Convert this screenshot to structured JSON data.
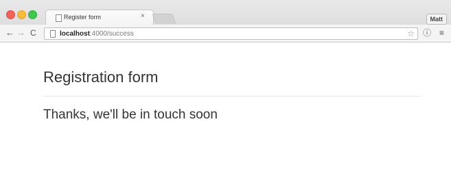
{
  "browser": {
    "tab": {
      "title": "Register form",
      "close_glyph": "×",
      "icon": "page-icon"
    },
    "profile_label": "Matt",
    "nav": {
      "back_glyph": "←",
      "forward_glyph": "→",
      "reload_glyph": "C"
    },
    "address_bar": {
      "host": "localhost",
      "path": ":4000/success",
      "icon": "page-icon",
      "bookmark_glyph": "☆"
    },
    "toolbar_icons": {
      "info_glyph": "ⓘ",
      "menu_glyph": "≡"
    },
    "window_controls": [
      "close",
      "minimize",
      "zoom"
    ]
  },
  "page": {
    "title": "Registration form",
    "message": "Thanks, we'll be in touch soon"
  },
  "colors": {
    "traffic_red": "#f2615a",
    "traffic_yellow": "#f7bd3a",
    "traffic_green": "#3fc84c",
    "text": "#333333"
  }
}
